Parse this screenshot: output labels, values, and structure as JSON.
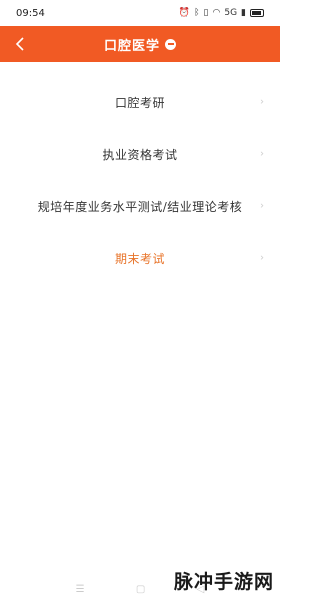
{
  "status_bar": {
    "time": "09:54",
    "icons": [
      "alarm-icon",
      "bluetooth-icon",
      "vibrate-icon",
      "wifi-icon",
      "signal-icon",
      "battery-icon"
    ],
    "network_label": "5G"
  },
  "header": {
    "title": "口腔医学",
    "background": "#f15a24"
  },
  "list": {
    "items": [
      {
        "label": "口腔考研",
        "active": false
      },
      {
        "label": "执业资格考试",
        "active": false
      },
      {
        "label": "规培年度业务水平测试/结业理论考核",
        "active": false
      },
      {
        "label": "期末考试",
        "active": true
      }
    ],
    "active_color": "#e8742a"
  },
  "nav_bar": {
    "buttons": [
      "menu",
      "home",
      "back"
    ]
  },
  "watermark": {
    "text": "脉冲手游网"
  }
}
